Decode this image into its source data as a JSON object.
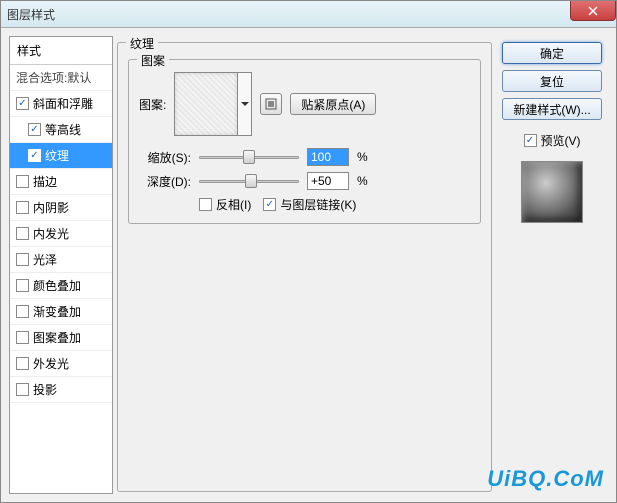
{
  "window": {
    "title": "图层样式"
  },
  "styles": {
    "header": "样式",
    "blend": "混合选项:默认",
    "items": [
      {
        "label": "斜面和浮雕",
        "checked": true,
        "selected": false,
        "indent": false
      },
      {
        "label": "等高线",
        "checked": true,
        "selected": false,
        "indent": true
      },
      {
        "label": "纹理",
        "checked": true,
        "selected": true,
        "indent": true
      },
      {
        "label": "描边",
        "checked": false,
        "selected": false,
        "indent": false
      },
      {
        "label": "内阴影",
        "checked": false,
        "selected": false,
        "indent": false
      },
      {
        "label": "内发光",
        "checked": false,
        "selected": false,
        "indent": false
      },
      {
        "label": "光泽",
        "checked": false,
        "selected": false,
        "indent": false
      },
      {
        "label": "颜色叠加",
        "checked": false,
        "selected": false,
        "indent": false
      },
      {
        "label": "渐变叠加",
        "checked": false,
        "selected": false,
        "indent": false
      },
      {
        "label": "图案叠加",
        "checked": false,
        "selected": false,
        "indent": false
      },
      {
        "label": "外发光",
        "checked": false,
        "selected": false,
        "indent": false
      },
      {
        "label": "投影",
        "checked": false,
        "selected": false,
        "indent": false
      }
    ]
  },
  "texture": {
    "group_title": "纹理",
    "pattern_group": "图案",
    "pattern_label": "图案:",
    "snap_btn": "贴紧原点(A)",
    "scale_label": "缩放(S):",
    "scale_value": "100",
    "scale_unit": "%",
    "depth_label": "深度(D):",
    "depth_value": "+50",
    "depth_unit": "%",
    "invert_label": "反相(I)",
    "invert_checked": false,
    "link_label": "与图层链接(K)",
    "link_checked": true
  },
  "right": {
    "ok": "确定",
    "cancel": "复位",
    "new_style": "新建样式(W)...",
    "preview_label": "预览(V)",
    "preview_checked": true
  },
  "watermark": "UiBQ.CoM"
}
